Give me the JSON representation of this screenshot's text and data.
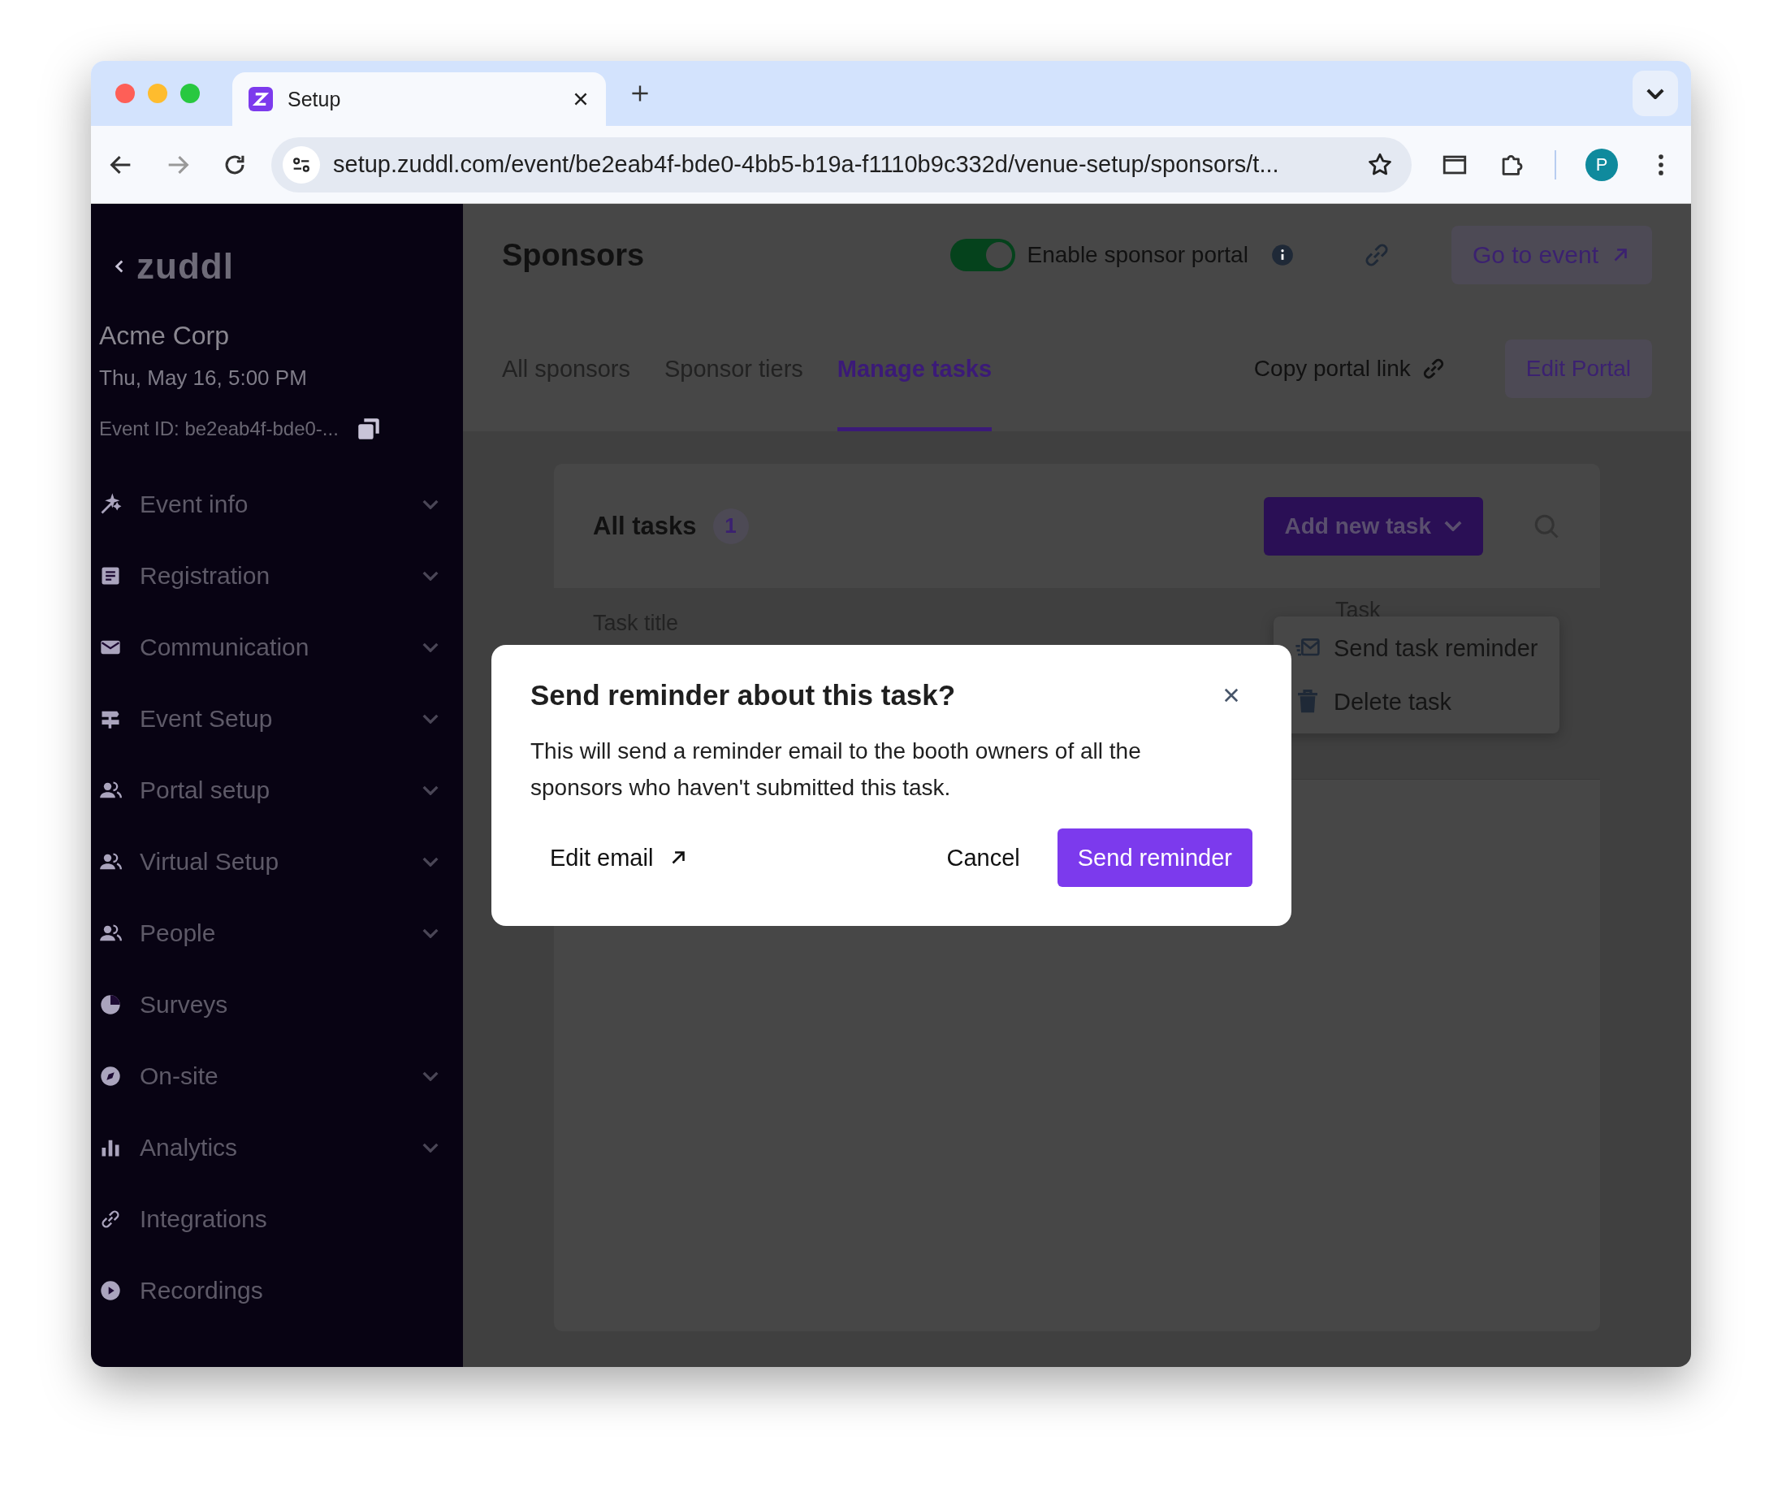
{
  "browser": {
    "tab_title": "Setup",
    "address": "setup.zuddl.com/event/be2eab4f-bde0-4bb5-b19a-f1110b9c332d/venue-setup/sponsors/t...",
    "profile_initial": "P"
  },
  "sidebar": {
    "logo": "zuddl",
    "org": "Acme Corp",
    "date": "Thu, May 16, 5:00 PM",
    "event_id": "Event ID: be2eab4f-bde0-...",
    "items": [
      {
        "label": "Event info",
        "expandable": true
      },
      {
        "label": "Registration",
        "expandable": true
      },
      {
        "label": "Communication",
        "expandable": true
      },
      {
        "label": "Event Setup",
        "expandable": true
      },
      {
        "label": "Portal setup",
        "expandable": true
      },
      {
        "label": "Virtual Setup",
        "expandable": true
      },
      {
        "label": "People",
        "expandable": true
      },
      {
        "label": "Surveys",
        "expandable": false
      },
      {
        "label": "On-site",
        "expandable": true
      },
      {
        "label": "Analytics",
        "expandable": true
      },
      {
        "label": "Integrations",
        "expandable": false
      },
      {
        "label": "Recordings",
        "expandable": false
      }
    ]
  },
  "header": {
    "title": "Sponsors",
    "portal_toggle": {
      "label": "Enable sponsor portal",
      "on": true
    },
    "go_to_event": "Go to event",
    "tabs": [
      {
        "label": "All sponsors",
        "selected": false
      },
      {
        "label": "Sponsor tiers",
        "selected": false
      },
      {
        "label": "Manage tasks",
        "selected": true
      }
    ],
    "copy_link": "Copy portal link",
    "edit_portal": "Edit Portal"
  },
  "tasks": {
    "title": "All tasks",
    "count": "1",
    "add_button": "Add new task",
    "columns": [
      "Task title",
      "Task"
    ]
  },
  "menu": {
    "items": [
      "Send task reminder",
      "Delete task"
    ]
  },
  "dialog": {
    "title": "Send reminder about this task?",
    "body": "This will send a reminder email to the booth owners of all the sponsors who haven't submitted this task.",
    "edit_email": "Edit email",
    "cancel": "Cancel",
    "confirm": "Send reminder"
  }
}
